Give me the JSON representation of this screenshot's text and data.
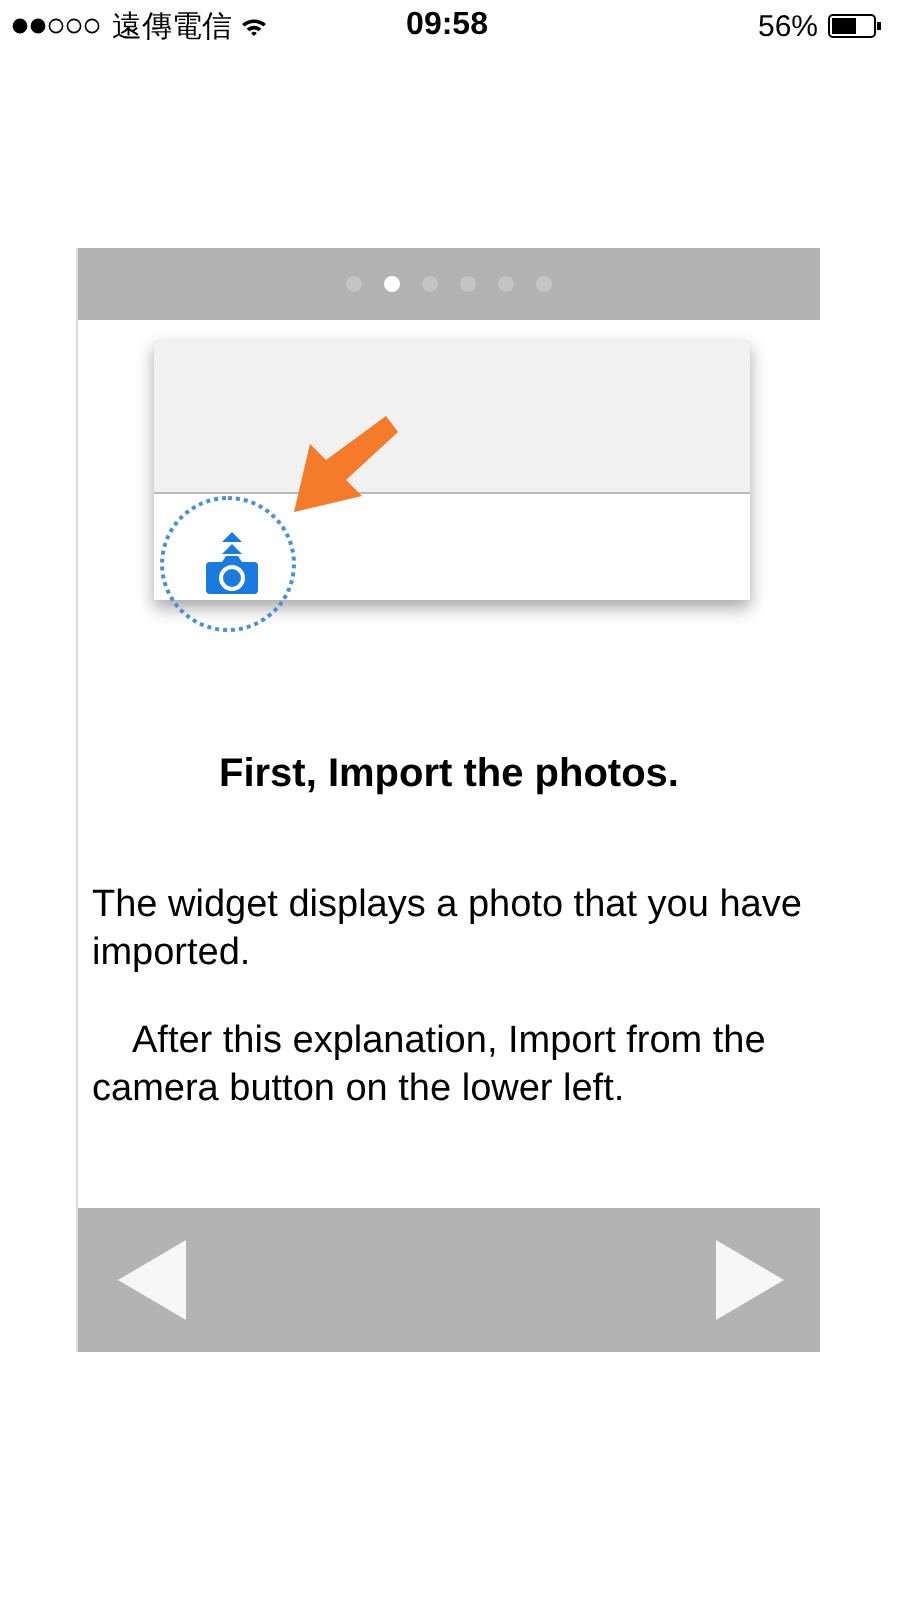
{
  "status_bar": {
    "carrier": "遠傳電信",
    "time": "09:58",
    "battery": "56%"
  },
  "page_dots": [
    {
      "selected": false
    },
    {
      "selected": true
    },
    {
      "selected": false
    },
    {
      "selected": false
    },
    {
      "selected": false
    },
    {
      "selected": false
    }
  ],
  "title": "First, Import the photos.",
  "paragraphs": [
    "The widget displays a photo that you have imported.",
    "After this explanation, Import from the camera button on the lower left."
  ],
  "nav": {
    "previous": {
      "disabled": false
    },
    "next": {
      "disabled": false
    }
  }
}
